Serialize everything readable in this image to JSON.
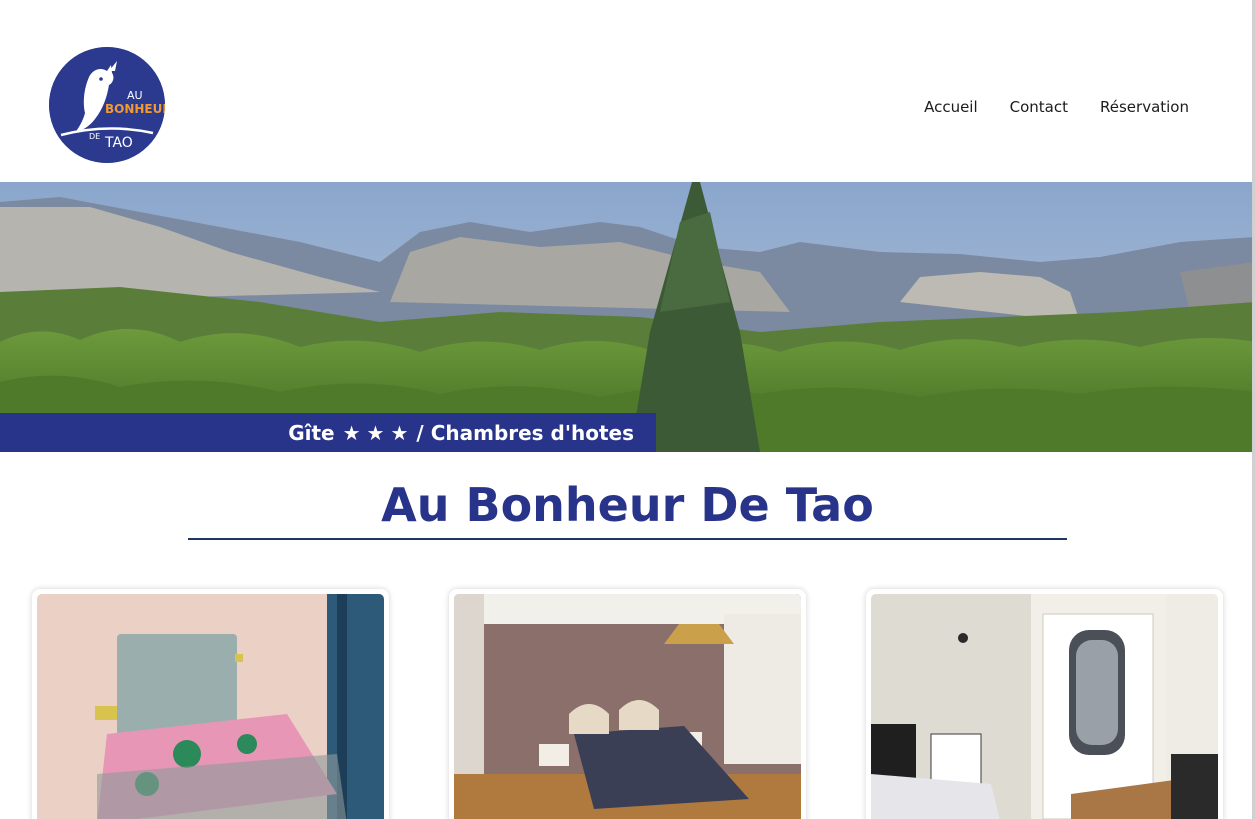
{
  "site": {
    "logo": {
      "lines": [
        "AU",
        "BONHEUR",
        "DE",
        "TAO"
      ],
      "colors": {
        "background": "#2b3a8f",
        "accent": "#f29a2e",
        "text": "#ffffff"
      }
    },
    "nav": [
      {
        "label": "Accueil"
      },
      {
        "label": "Contact"
      },
      {
        "label": "Réservation"
      }
    ]
  },
  "hero": {
    "banner_text_before": "Gîte",
    "stars": "★★★",
    "star_count": 3,
    "banner_text_after": "/ Chambres d'hotes",
    "banner_color": "#28338a"
  },
  "main": {
    "title": "Au Bonheur De Tao",
    "title_color": "#28338a"
  },
  "rooms": [
    {
      "photo": "bedroom-photo-pink-floral-bedspread"
    },
    {
      "photo": "bedroom-photo-grey-duvet"
    },
    {
      "photo": "bedroom-photo-mirrored-wardrobe"
    }
  ]
}
